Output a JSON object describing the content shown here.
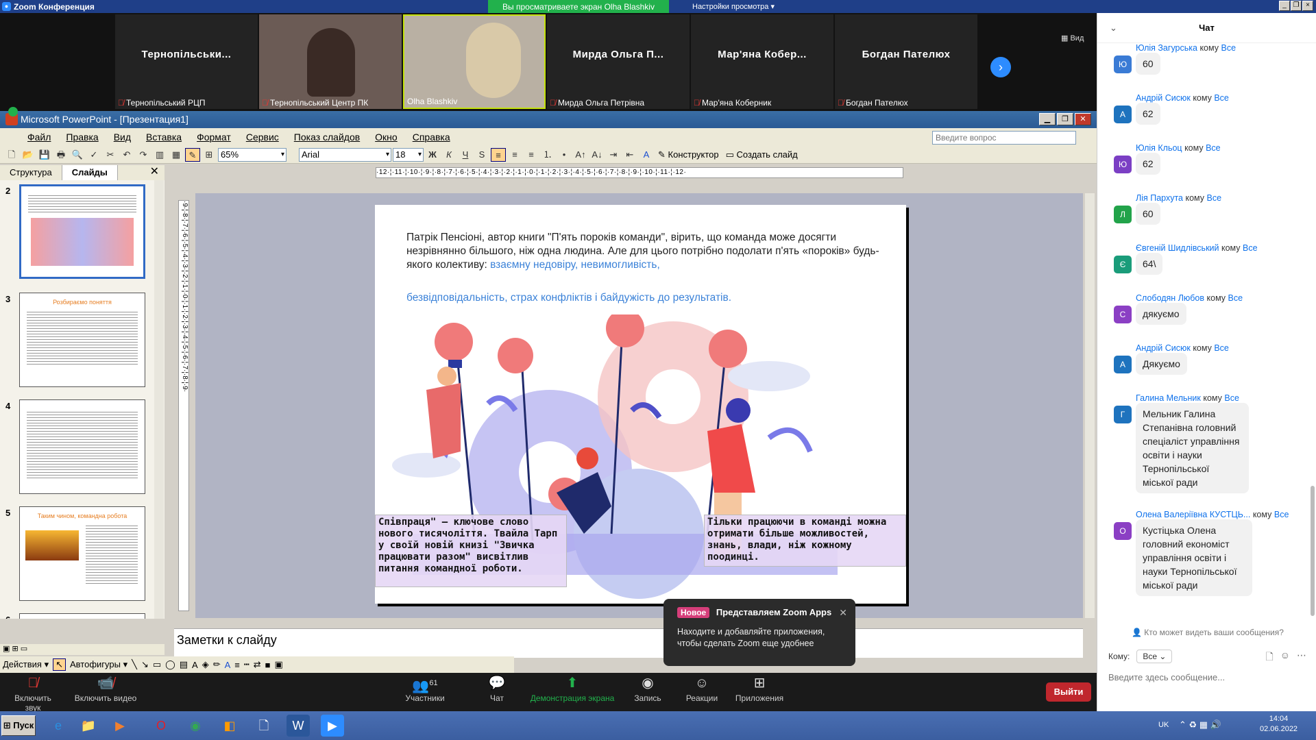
{
  "zoom": {
    "window_title": "Zoom Конференция",
    "share_banner": "Вы просматриваете экран Olha Blashkiv",
    "view_options": "Настройки просмотра",
    "view_button": "Вид"
  },
  "gallery": [
    {
      "big": "Тернопільськи...",
      "small": "Тернопільський РЦП",
      "video": false,
      "muted": true
    },
    {
      "big": "",
      "small": "Тернопільський Центр ПК",
      "video": true,
      "muted": true
    },
    {
      "big": "",
      "small": "Olha Blashkiv",
      "video": true,
      "muted": false
    },
    {
      "big": "Мирда Ольга П...",
      "small": "Мирда Ольга Петрівна",
      "video": false,
      "muted": true
    },
    {
      "big": "Мар'яна Кобер...",
      "small": "Мар'яна Коберник",
      "video": false,
      "muted": true
    },
    {
      "big": "Богдан Пателюх",
      "small": "Богдан Пателюх",
      "video": false,
      "muted": true
    }
  ],
  "ppt": {
    "title": "Microsoft PowerPoint - [Презентация1]",
    "menu": [
      "Файл",
      "Правка",
      "Вид",
      "Вставка",
      "Формат",
      "Сервис",
      "Показ слайдов",
      "Окно",
      "Справка"
    ],
    "ask_placeholder": "Введите вопрос",
    "zoom": "65%",
    "font": "Arial",
    "font_size": "18",
    "designer": "Конструктор",
    "new_slide": "Создать слайд",
    "tab_outline": "Структура",
    "tab_slides": "Слайды",
    "ruler_h": "·12·¦·11·¦·10·¦·9·¦·8·¦·7·¦·6·¦·5·¦·4·¦·3·¦·2·¦·1·¦·0·¦·1·¦·2·¦·3·¦·4·¦·5·¦·6·¦·7·¦·8·¦·9·¦·10·¦·11·¦·12·",
    "ruler_v": "·9·¦·8·¦·7·¦·6·¦·5·¦·4·¦·3·¦·2·¦·1·¦·0·¦·1·¦·2·¦·3·¦·4·¦·5·¦·6·¦·7·¦·8·¦·9·",
    "thumbs": [
      {
        "num": "2",
        "title": ""
      },
      {
        "num": "3",
        "title": "Розбираємо поняття"
      },
      {
        "num": "4",
        "title": ""
      },
      {
        "num": "5",
        "title": "Таким чином, командна робота"
      },
      {
        "num": "6",
        "title": ""
      }
    ],
    "slide": {
      "text1_black": "Патрік Пенсіоні, автор  книги \"П'ять пороків команди\", вірить, що команда може досягти незрівнянно більшого, ніж одна людина. Але для цього потрібно подолати п'ять «пороків» будь-якого колективу:",
      "text1_blue": " взаємну недовіру, невимогливість,",
      "text2": "безвідповідальність, страх конфліктів і байдужість до результатів.",
      "callout1": "Співпраця\" – ключове слово нового тисячоліття. Твайла Тарп у своїй новій книзі \"Звичка працювати разом\" висвітлив питання командної роботи.",
      "callout2": "Тільки працюючи в команді можна отримати більше можливостей, знань, влади, ніж кожному поодинці."
    },
    "notes": "Заметки к слайду",
    "actions": "Действия",
    "autoshapes": "Автофигуры"
  },
  "controls": {
    "mute": "Включить звук",
    "video": "Включить видео",
    "participants": "Участники",
    "participants_count": "61",
    "chat": "Чат",
    "share": "Демонстрация экрана",
    "record": "Запись",
    "reactions": "Реакции",
    "apps": "Приложения",
    "end": "Выйти"
  },
  "apps_tip": {
    "badge": "Новое",
    "title": "Представляем Zoom Apps",
    "desc": "Находите и добавляйте приложения, чтобы сделать Zoom еще удобнее"
  },
  "chat": {
    "title": "Чат",
    "to_word": "кому",
    "messages": [
      {
        "from": "Юлія Загурська",
        "to": "Все",
        "avatar": "Ю",
        "color": "#3a7bd5",
        "text": "60"
      },
      {
        "from": "Андрій Сисюк",
        "to": "Все",
        "avatar": "А",
        "color": "#1e73be",
        "text": "62"
      },
      {
        "from": "Юлія Кльоц",
        "to": "Все",
        "avatar": "Ю",
        "color": "#7b3fc4",
        "text": "62"
      },
      {
        "from": "Лія Пархута",
        "to": "Все",
        "avatar": "Л",
        "color": "#22a34a",
        "text": "60"
      },
      {
        "from": "Євгеній Шидлівський",
        "to": "Все",
        "avatar": "Є",
        "color": "#1a9c7a",
        "text": "64\\"
      },
      {
        "from": "Слободян  Любов",
        "to": "Все",
        "avatar": "С",
        "color": "#8b3fc4",
        "text": "дякуємо"
      },
      {
        "from": "Андрій Сисюк",
        "to": "Все",
        "avatar": "А",
        "color": "#1e73be",
        "text": "Дякуємо"
      },
      {
        "from": "Галина Мельник",
        "to": "Все",
        "avatar": "Г",
        "color": "#1e73be",
        "text": "Мельник Галина Степанівна головний спеціаліст управління освіти і науки Тернопільської міської ради"
      },
      {
        "from": "Олена  Валеріївна КУСТЦЬ...",
        "to": "Все",
        "avatar": "О",
        "color": "#8b3fc4",
        "text": "Кустіцька Олена головний економіст управління освіти і науки Тернопільської міської ради"
      }
    ],
    "privacy": "Кто может видеть ваши сообщения?",
    "to_label": "Кому:",
    "to_value": "Все",
    "input_placeholder": "Введите здесь сообщение..."
  },
  "taskbar": {
    "start": "Пуск",
    "lang": "UK",
    "time": "14:04",
    "date": "02.06.2022"
  }
}
